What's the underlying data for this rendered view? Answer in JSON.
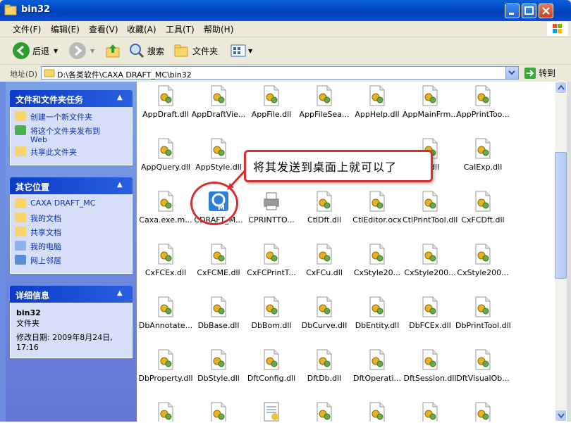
{
  "window": {
    "title": "bin32"
  },
  "menubar": {
    "items": [
      "文件(F)",
      "编辑(E)",
      "查看(V)",
      "收藏(A)",
      "工具(T)",
      "帮助(H)"
    ]
  },
  "toolbar": {
    "back_label": "后退",
    "search_label": "搜索",
    "folders_label": "文件夹"
  },
  "address": {
    "label": "地址(D)",
    "path": "D:\\各类软件\\CAXA DRAFT_MC\\bin32",
    "go_label": "转到"
  },
  "sidebar": {
    "tasks": {
      "title": "文件和文件夹任务",
      "items": [
        "创建一个新文件夹",
        "将这个文件夹发布到",
        "Web",
        "共享此文件夹"
      ]
    },
    "places": {
      "title": "其它位置",
      "items": [
        "CAXA DRAFT_MC",
        "我的文档",
        "共享文档",
        "我的电脑",
        "网上邻居"
      ]
    },
    "details": {
      "title": "详细信息",
      "name": "bin32",
      "type": "文件夹",
      "modified": "修改日期: 2009年8月24日,",
      "time": "17:16"
    }
  },
  "files": [
    "AppDraft.dll",
    "AppDraftVie...",
    "AppFile.dll",
    "AppFileSea...",
    "AppHelp.dll",
    "AppMainFrm...",
    "AppPrintToo...",
    "AppQuery.dll",
    "AppStyle.dll",
    "",
    "",
    "",
    "ol.dll",
    "CalExp.dll",
    "Caxa.exe.m...",
    "CDRAFT_M...",
    "CPRINTTO...",
    "CtlDft.dll",
    "CtlEditor.ocx",
    "CtlPrintTool.dll",
    "CxFCDft.dll",
    "CxFCEx.dll",
    "CxFCME.dll",
    "CxFCPrintT...",
    "CxFCu.dll",
    "CxStyle20...",
    "CxStyle200...",
    "CxStyle200...",
    "DbAnnotate...",
    "DbBase.dll",
    "DbBom.dll",
    "DbCurve.dll",
    "DbEntity.dll",
    "DbFCEx.dll",
    "DbPrintTool.dll",
    "DbProperty.dll",
    "DbStyle.dll",
    "DftConfig.dll",
    "DftDb.dll",
    "DftOperati...",
    "DftSession.dll",
    "DftVisualOb..."
  ],
  "callout": {
    "text": "将其发送到桌面上就可以了"
  },
  "colors": {
    "titlebar": "#0049c5",
    "sidebar": "#7ba2e7",
    "annotation": "#d43030"
  }
}
